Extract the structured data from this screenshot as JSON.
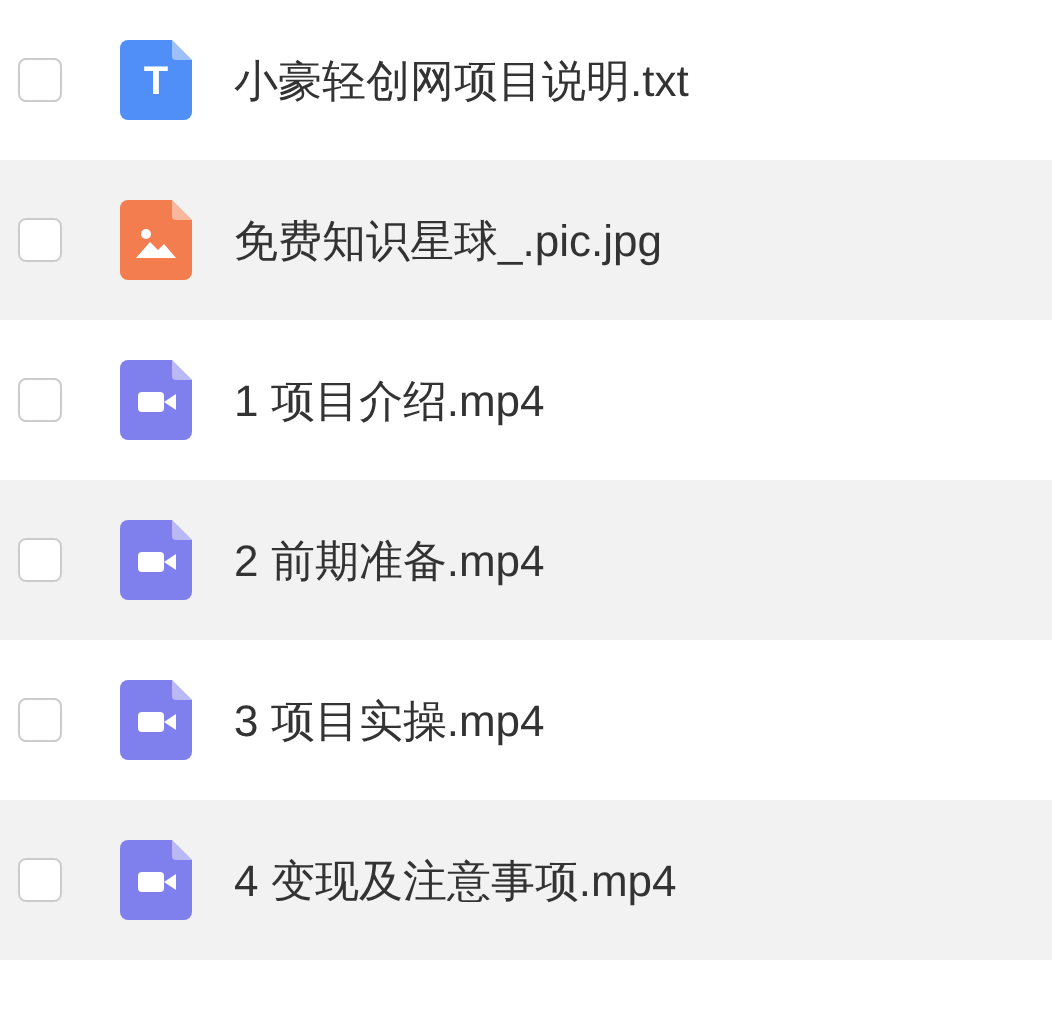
{
  "files": [
    {
      "kind": "text",
      "icon_text": "T",
      "name": "小豪轻创网项目说明.txt",
      "checked": false
    },
    {
      "kind": "image",
      "name": "免费知识星球_.pic.jpg",
      "checked": false
    },
    {
      "kind": "video",
      "name": "1 项目介绍.mp4",
      "checked": false
    },
    {
      "kind": "video",
      "name": "2 前期准备.mp4",
      "checked": false
    },
    {
      "kind": "video",
      "name": "3 项目实操.mp4",
      "checked": false
    },
    {
      "kind": "video",
      "name": "4 变现及注意事项.mp4",
      "checked": false
    }
  ]
}
